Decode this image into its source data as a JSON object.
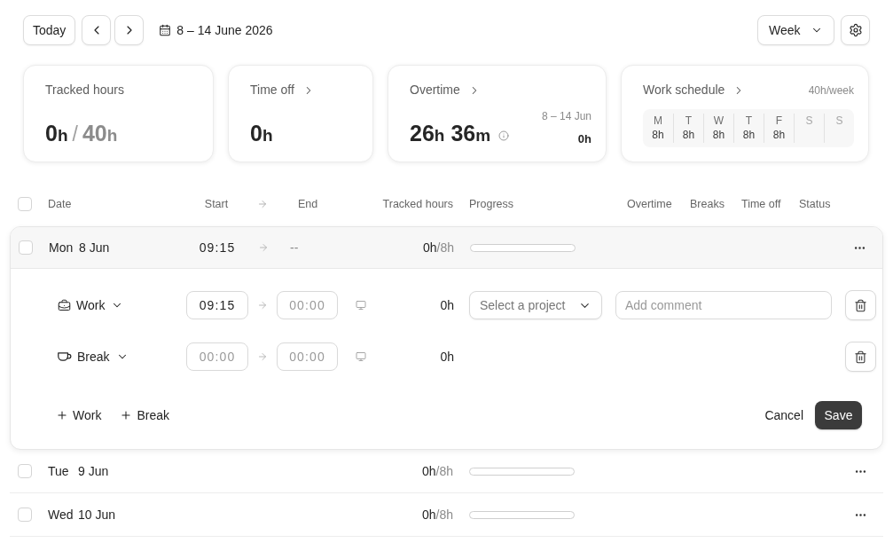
{
  "toolbar": {
    "today": "Today",
    "date_range": "8 – 14 June 2026",
    "view": "Week"
  },
  "summary_cards": [
    {
      "kind": "tracked",
      "title": "Tracked hours",
      "linked": false,
      "value": [
        {
          "number": "0",
          "unit": "h"
        }
      ],
      "separator": "/",
      "total": [
        {
          "number": "40",
          "unit": "h"
        }
      ]
    },
    {
      "kind": "time_off",
      "title": "Time off",
      "linked": true,
      "value": [
        {
          "number": "0",
          "unit": "h"
        }
      ]
    },
    {
      "kind": "overtime",
      "title": "Overtime",
      "linked": true,
      "value": [
        {
          "number": "26",
          "unit": "h"
        },
        {
          "number": "36",
          "unit": "m"
        }
      ],
      "period": "8 – 14 Jun",
      "period_value": "0h"
    },
    {
      "kind": "schedule",
      "title": "Work schedule",
      "linked": true,
      "rate": "40h/week",
      "days": [
        {
          "day": "M",
          "hours": "8h",
          "working": true
        },
        {
          "day": "T",
          "hours": "8h",
          "working": true
        },
        {
          "day": "W",
          "hours": "8h",
          "working": true
        },
        {
          "day": "T",
          "hours": "8h",
          "working": true
        },
        {
          "day": "F",
          "hours": "8h",
          "working": true
        },
        {
          "day": "S",
          "working": false
        },
        {
          "day": "S",
          "working": false
        }
      ]
    }
  ],
  "table": {
    "select_all": {
      "checked": false
    },
    "columns": [
      "Date",
      "Start",
      "End",
      "Tracked hours",
      "Progress",
      "Overtime",
      "Breaks",
      "Time off",
      "Status"
    ],
    "rows": [
      {
        "weekday": "Mon",
        "date": "8 Jun",
        "start": "09:15",
        "end": "--",
        "tracked": "**0h**/8h",
        "level": 0,
        "checked": false,
        "expanded": true,
        "editor": {
          "entries": [
            {
              "kind": "work",
              "label": "Work",
              "start": {
                "value": "09:15"
              },
              "end": {
                "placeholder": "00:00"
              },
              "duration": "0h",
              "project": "Select a project",
              "comment": {
                "placeholder": "Add comment"
              }
            },
            {
              "kind": "break",
              "label": "Break",
              "start": {
                "placeholder": "00:00"
              },
              "end": {
                "placeholder": "00:00"
              },
              "duration": "0h"
            }
          ],
          "add": [
            "Work",
            "Break"
          ],
          "cancel": "Cancel",
          "save": "Save"
        }
      },
      {
        "weekday": "Tue",
        "date": "9 Jun",
        "tracked": "**0h**/8h",
        "level": 0,
        "checked": false,
        "expanded": false
      },
      {
        "weekday": "Wed",
        "date": "10 Jun",
        "tracked": "**0h**/8h",
        "level": 0,
        "checked": false,
        "expanded": false
      }
    ]
  }
}
